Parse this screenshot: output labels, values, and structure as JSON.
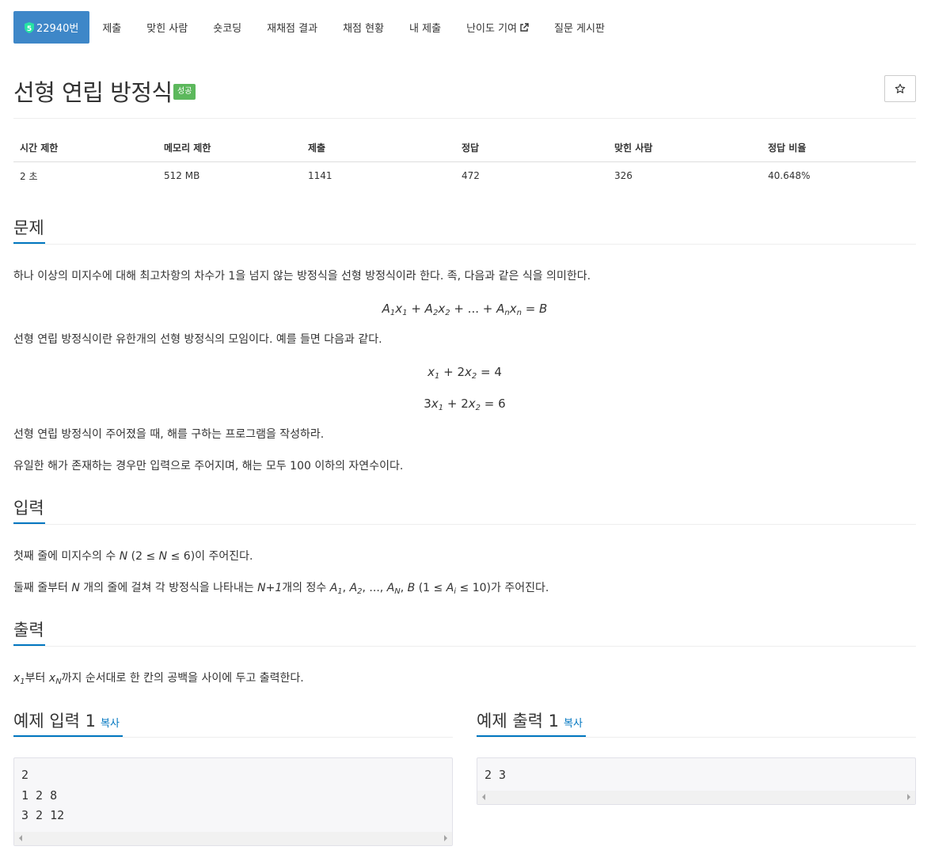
{
  "nav": {
    "problem_badge_icon": "shield-icon",
    "problem_number": "22940번",
    "items": [
      {
        "label": "제출"
      },
      {
        "label": "맞힌 사람"
      },
      {
        "label": "숏코딩"
      },
      {
        "label": "재채점 결과"
      },
      {
        "label": "채점 현황"
      },
      {
        "label": "내 제출"
      },
      {
        "label": "난이도 기여"
      },
      {
        "label": "질문 게시판"
      }
    ]
  },
  "problem": {
    "title": "선형 연립 방정식",
    "status_badge": "성공",
    "star_icon": "star-icon"
  },
  "info": {
    "headers": [
      "시간 제한",
      "메모리 제한",
      "제출",
      "정답",
      "맞힌 사람",
      "정답 비율"
    ],
    "values": [
      "2 초",
      "512 MB",
      "1141",
      "472",
      "326",
      "40.648%"
    ]
  },
  "sections": {
    "problem": {
      "heading": "문제",
      "p1": "하나 이상의 미지수에 대해 최고차항의 차수가 1을 넘지 않는 방정식을 선형 방정식이라 한다. 족, 다음과 같은 식을 의미한다.",
      "p2": "선형 연립 방정식이란 유한개의 선형 방정식의 모임이다. 예를 들면 다음과 같다.",
      "p3": "선형 연립 방정식이 주어졌을 때, 해를 구하는 프로그램을 작성하라.",
      "p4": "유일한 해가 존재하는 경우만 입력으로 주어지며, 해는 모두 100 이하의 자연수이다."
    },
    "input": {
      "heading": "입력",
      "p1_a": "첫째 줄에 미지수의 수 ",
      "p1_b": "이 주어진다.",
      "p2_a": "둘째 줄부터 ",
      "p2_b": " 개의 줄에 걸쳐 각 방정식을 나타내는 ",
      "p2_c": "개의 정수 ",
      "p2_d": "가 주어진다."
    },
    "output": {
      "heading": "출력",
      "p1_a": "부터 ",
      "p1_b": "까지 순서대로 한 칸의 공백을 사이에 두고 출력한다."
    },
    "sample_input": {
      "heading": "예제 입력 1",
      "copy": "복사",
      "content": "2\n1 2 8\n3 2 12"
    },
    "sample_output": {
      "heading": "예제 출력 1",
      "copy": "복사",
      "content": "2 3"
    }
  }
}
